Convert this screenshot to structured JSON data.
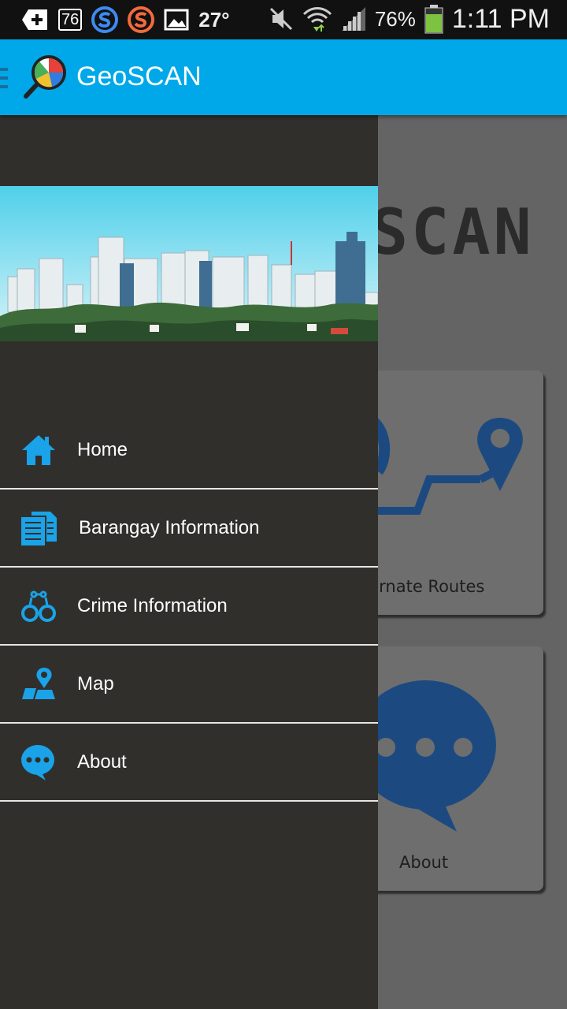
{
  "status_bar": {
    "badge_76": "76",
    "temperature": "27°",
    "battery": "76%",
    "time": "1:11 PM",
    "icons": [
      "add-icon",
      "badge-icon",
      "s-app-icon",
      "s-app-orange-icon",
      "image-icon",
      "mute-icon",
      "wifi-icon",
      "signal-icon",
      "battery-icon"
    ]
  },
  "app_bar": {
    "title": "GeoSCAN",
    "logo": "geoscan-logo-icon",
    "menu": "hamburger-icon",
    "color": "#00a8ea"
  },
  "background": {
    "title_fragment": "SCAN",
    "cards": [
      {
        "label": "ternate Routes",
        "icon": "route-icon"
      },
      {
        "label": "About",
        "icon": "chat-bubble-icon"
      }
    ]
  },
  "drawer": {
    "header_image": "city-skyline-image",
    "accent_color": "#1aa3e8",
    "items": [
      {
        "label": "Home",
        "icon": "home-icon"
      },
      {
        "label": "Barangay Information",
        "icon": "document-icon"
      },
      {
        "label": "Crime Information",
        "icon": "handcuffs-icon"
      },
      {
        "label": "Map",
        "icon": "map-pin-icon"
      },
      {
        "label": "About",
        "icon": "chat-bubble-icon"
      }
    ]
  }
}
